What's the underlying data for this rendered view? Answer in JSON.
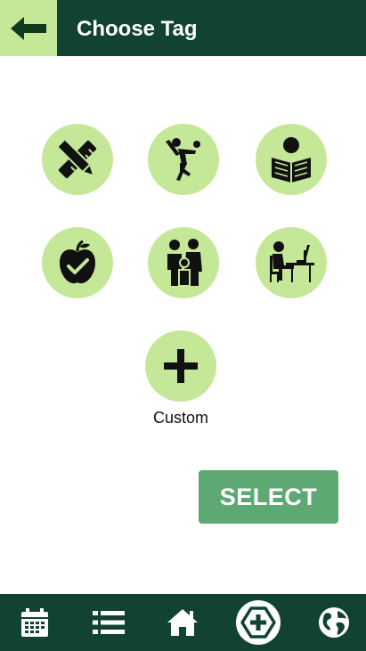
{
  "header": {
    "title": "Choose Tag",
    "back_icon": "arrow-left-icon"
  },
  "tags": [
    {
      "name": "study",
      "icon": "pencil-ruler-icon"
    },
    {
      "name": "sport",
      "icon": "volleyball-player-icon"
    },
    {
      "name": "reading",
      "icon": "person-reading-icon"
    },
    {
      "name": "health",
      "icon": "apple-check-icon"
    },
    {
      "name": "family",
      "icon": "family-icon"
    },
    {
      "name": "work",
      "icon": "desk-worker-icon"
    }
  ],
  "custom": {
    "label": "Custom",
    "icon": "plus-icon"
  },
  "select_button": {
    "label": "SELECT"
  },
  "bottom_nav": [
    {
      "icon": "calendar-icon"
    },
    {
      "icon": "list-icon"
    },
    {
      "icon": "home-icon"
    },
    {
      "icon": "add-circle-icon",
      "active": true
    },
    {
      "icon": "globe-icon"
    }
  ],
  "colors": {
    "header": "#114232",
    "accent_light": "#c5e898",
    "button": "#5ea873"
  }
}
